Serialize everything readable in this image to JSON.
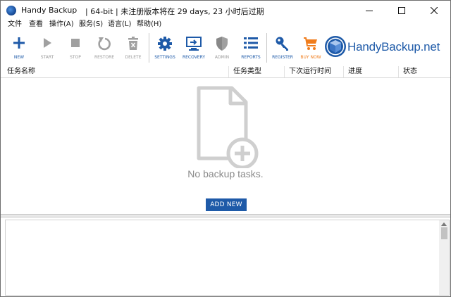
{
  "window": {
    "app_name": "Handy Backup",
    "info": "| 64-bit | 未注册版本将在 29 days, 23 小时后过期"
  },
  "menu": [
    {
      "label": "文件"
    },
    {
      "label": "查看"
    },
    {
      "label": "操作(A)"
    },
    {
      "label": "服务(S)"
    },
    {
      "label": "语言(L)"
    },
    {
      "label": "帮助(H)"
    }
  ],
  "toolbar": {
    "new": "NEW",
    "start": "START",
    "stop": "STOP",
    "restore": "RESTORE",
    "delete": "DELETE",
    "settings": "SETTINGS",
    "recovery": "RECOVERY",
    "admin": "ADMIN",
    "reports": "REPORTS",
    "register": "REGISTER",
    "buy_now": "BUY NOW"
  },
  "logo": {
    "text": "HandyBackup.net"
  },
  "table": {
    "columns": [
      "任务名称",
      "任务类型",
      "下次运行时间",
      "进度",
      "状态"
    ]
  },
  "empty": {
    "message": "No backup tasks.",
    "add_button": "ADD NEW"
  },
  "colors": {
    "accent": "#1e5aa8",
    "buy": "#f07c1b",
    "disabled": "#9a9a9a"
  }
}
